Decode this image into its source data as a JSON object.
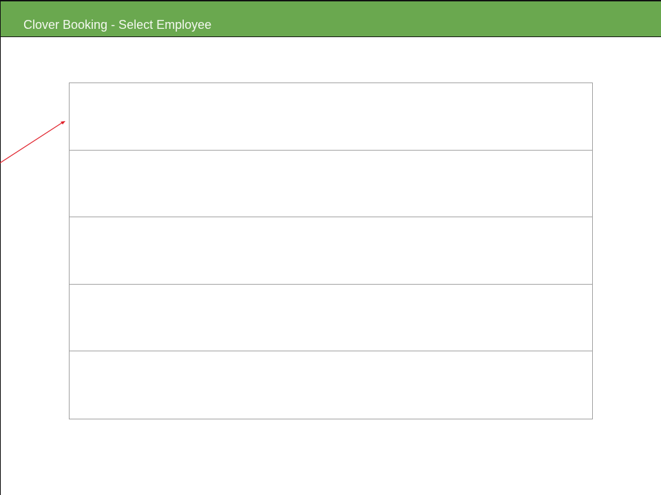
{
  "header": {
    "title": "Clover Booking - Select Employee",
    "background_color": "#6aa84f"
  },
  "employee_list": {
    "rows": [
      "",
      "",
      "",
      "",
      ""
    ]
  },
  "annotation": {
    "arrow_color": "#e0202a",
    "icon": "arrow-icon"
  }
}
